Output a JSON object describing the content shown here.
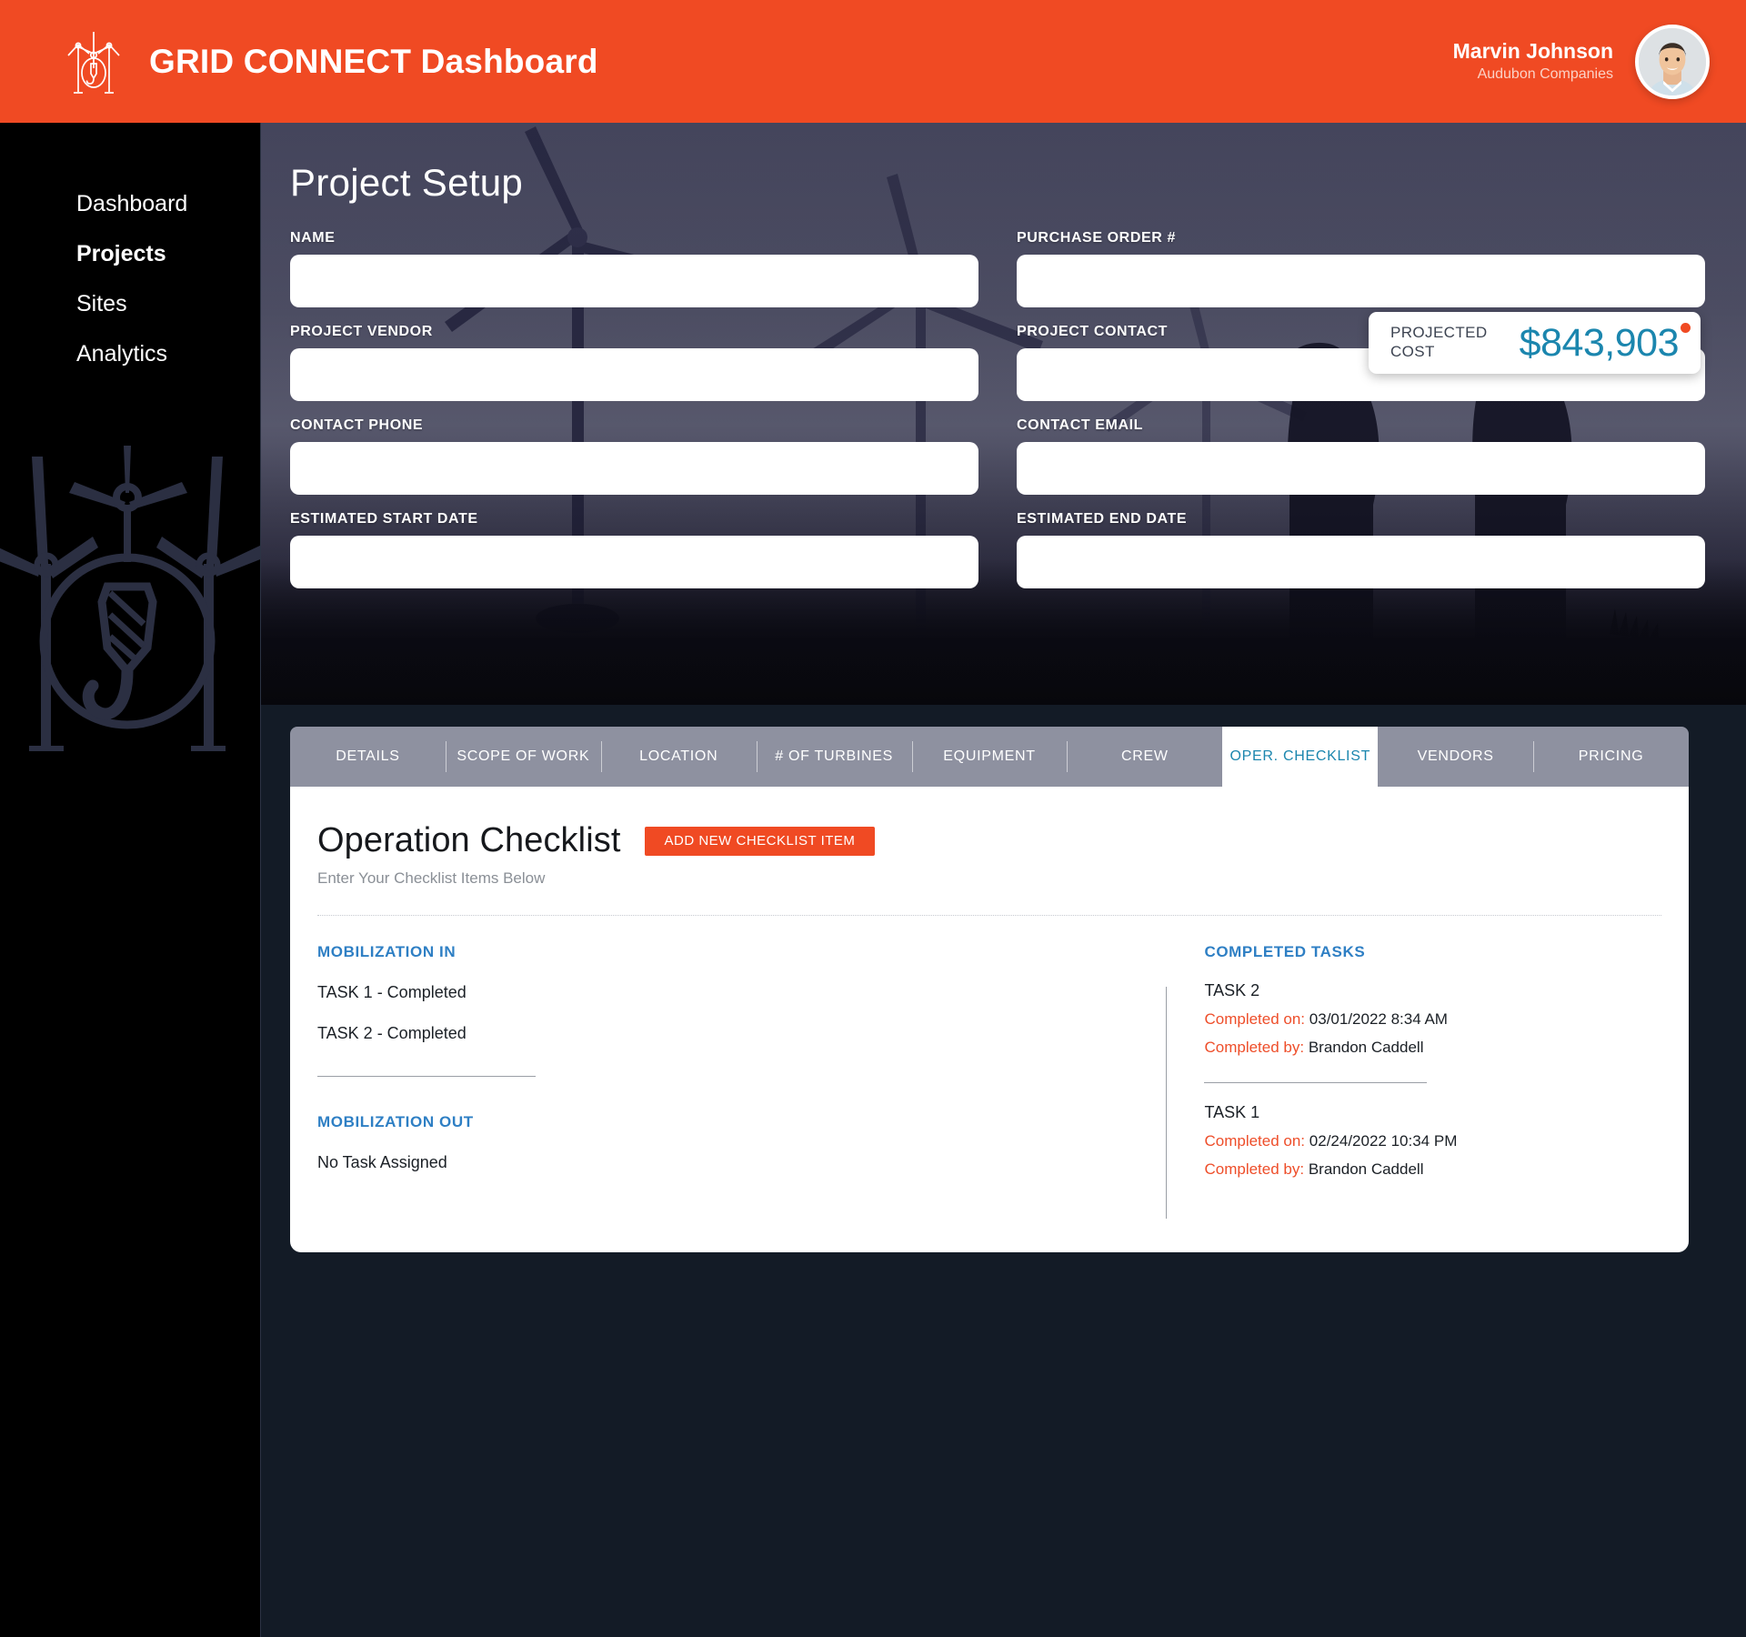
{
  "header": {
    "logo_icon": "wind-turbine-crane-hook-icon",
    "title": "GRID CONNECT Dashboard",
    "brand_color": "#f04a23",
    "user": {
      "name": "Marvin Johnson",
      "org": "Audubon Companies",
      "avatar_icon": "user-avatar-photo"
    }
  },
  "sidebar": {
    "items": [
      {
        "label": "Dashboard",
        "active": false
      },
      {
        "label": "Projects",
        "active": true
      },
      {
        "label": "Sites",
        "active": false
      },
      {
        "label": "Analytics",
        "active": false
      }
    ],
    "watermark_icon": "wind-turbine-crane-hook-watermark"
  },
  "hero": {
    "page_title": "Project Setup",
    "cost_card": {
      "label": "PROJECTED\nCOST",
      "value": "$843,903",
      "value_color": "#1b86ae",
      "dot_color": "#f04a23"
    },
    "fields": [
      {
        "label": "NAME",
        "value": "",
        "placeholder": ""
      },
      {
        "label": "PURCHASE ORDER #",
        "value": "",
        "placeholder": ""
      },
      {
        "label": "PROJECT VENDOR",
        "value": "",
        "placeholder": ""
      },
      {
        "label": "PROJECT CONTACT",
        "value": "",
        "placeholder": ""
      },
      {
        "label": "CONTACT PHONE",
        "value": "",
        "placeholder": ""
      },
      {
        "label": "CONTACT EMAIL",
        "value": "",
        "placeholder": ""
      },
      {
        "label": "ESTIMATED START DATE",
        "value": "",
        "placeholder": ""
      },
      {
        "label": "ESTIMATED END DATE",
        "value": "",
        "placeholder": ""
      }
    ]
  },
  "panel": {
    "tabs": [
      {
        "label": "DETAILS",
        "active": false
      },
      {
        "label": "SCOPE OF WORK",
        "active": false
      },
      {
        "label": "LOCATION",
        "active": false
      },
      {
        "label": "# OF TURBINES",
        "active": false
      },
      {
        "label": "EQUIPMENT",
        "active": false
      },
      {
        "label": "CREW",
        "active": false
      },
      {
        "label": "OPER. CHECKLIST",
        "active": true
      },
      {
        "label": "VENDORS",
        "active": false
      },
      {
        "label": "PRICING",
        "active": false
      }
    ],
    "active_tab_color": "#1b86ae",
    "title": "Operation Checklist",
    "add_button": "ADD NEW CHECKLIST ITEM",
    "subtitle": "Enter Your Checklist Items Below",
    "mobilization_in": {
      "heading": "MOBILIZATION IN",
      "tasks": [
        "TASK 1 - Completed",
        "TASK 2 - Completed"
      ]
    },
    "mobilization_out": {
      "heading": "MOBILIZATION OUT",
      "tasks": [
        "No Task Assigned"
      ]
    },
    "completed_tasks": {
      "heading": "COMPLETED TASKS",
      "completed_on_label": "Completed on:",
      "completed_by_label": "Completed by:",
      "items": [
        {
          "name": "TASK 2",
          "completed_on": "03/01/2022   8:34 AM",
          "completed_by": "Brandon Caddell"
        },
        {
          "name": "TASK 1",
          "completed_on": "02/24/2022   10:34 PM",
          "completed_by": "Brandon Caddell"
        }
      ]
    }
  }
}
